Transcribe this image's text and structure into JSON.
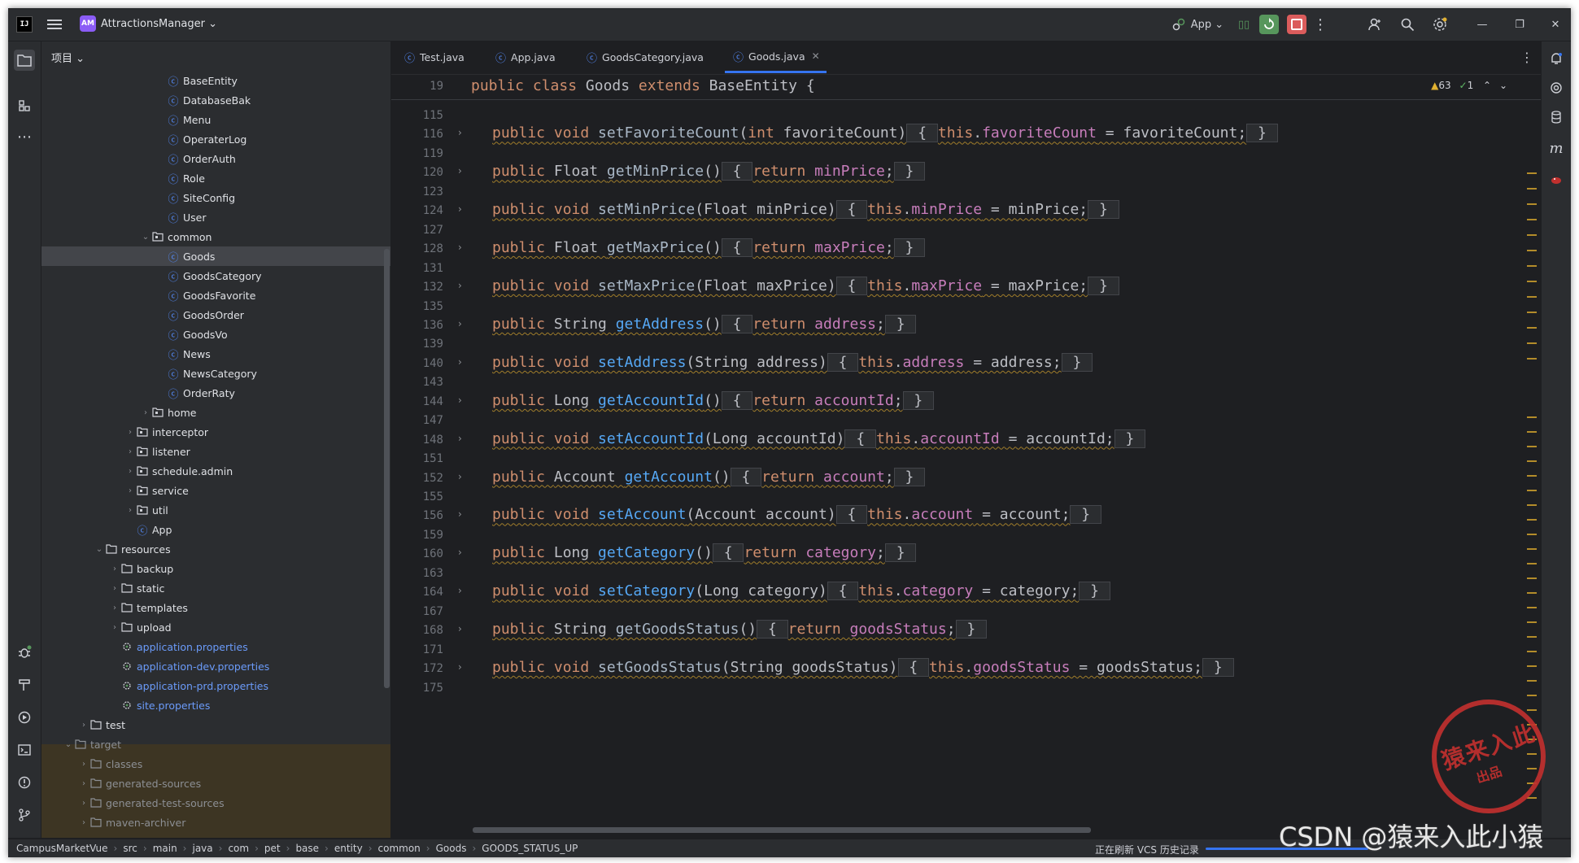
{
  "titlebar": {
    "logo": "IJ",
    "project_badge": "AM",
    "project_name": "AttractionsManager ⌄",
    "run_config": "App ⌄"
  },
  "project_panel": {
    "title": "项目 ⌄",
    "tree": [
      {
        "label": "BaseEntity",
        "type": "class",
        "indent": 6
      },
      {
        "label": "DatabaseBak",
        "type": "class",
        "indent": 6
      },
      {
        "label": "Menu",
        "type": "class",
        "indent": 6
      },
      {
        "label": "OperaterLog",
        "type": "class",
        "indent": 6
      },
      {
        "label": "OrderAuth",
        "type": "class",
        "indent": 6
      },
      {
        "label": "Role",
        "type": "class",
        "indent": 6
      },
      {
        "label": "SiteConfig",
        "type": "class",
        "indent": 6
      },
      {
        "label": "User",
        "type": "class",
        "indent": 6
      },
      {
        "label": "common",
        "type": "package",
        "indent": 5,
        "open": true
      },
      {
        "label": "Goods",
        "type": "class",
        "indent": 6,
        "selected": true
      },
      {
        "label": "GoodsCategory",
        "type": "class",
        "indent": 6
      },
      {
        "label": "GoodsFavorite",
        "type": "class",
        "indent": 6
      },
      {
        "label": "GoodsOrder",
        "type": "class",
        "indent": 6
      },
      {
        "label": "GoodsVo",
        "type": "class",
        "indent": 6
      },
      {
        "label": "News",
        "type": "class",
        "indent": 6
      },
      {
        "label": "NewsCategory",
        "type": "class",
        "indent": 6
      },
      {
        "label": "OrderRaty",
        "type": "class",
        "indent": 6
      },
      {
        "label": "home",
        "type": "package",
        "indent": 5,
        "open": false
      },
      {
        "label": "interceptor",
        "type": "package",
        "indent": 4,
        "open": false
      },
      {
        "label": "listener",
        "type": "package",
        "indent": 4,
        "open": false
      },
      {
        "label": "schedule.admin",
        "type": "package",
        "indent": 4,
        "open": false
      },
      {
        "label": "service",
        "type": "package",
        "indent": 4,
        "open": false
      },
      {
        "label": "util",
        "type": "package",
        "indent": 4,
        "open": false
      },
      {
        "label": "App",
        "type": "app",
        "indent": 4
      },
      {
        "label": "resources",
        "type": "folder",
        "indent": 2,
        "open": true
      },
      {
        "label": "backup",
        "type": "folder",
        "indent": 3,
        "open": false
      },
      {
        "label": "static",
        "type": "folder",
        "indent": 3,
        "open": false
      },
      {
        "label": "templates",
        "type": "folder",
        "indent": 3,
        "open": false
      },
      {
        "label": "upload",
        "type": "folder",
        "indent": 3,
        "open": false
      },
      {
        "label": "application.properties",
        "type": "props",
        "indent": 3
      },
      {
        "label": "application-dev.properties",
        "type": "props",
        "indent": 3
      },
      {
        "label": "application-prd.properties",
        "type": "props",
        "indent": 3
      },
      {
        "label": "site.properties",
        "type": "props",
        "indent": 3
      },
      {
        "label": "test",
        "type": "folder",
        "indent": 1,
        "open": false
      },
      {
        "label": "target",
        "type": "folder",
        "indent": 0,
        "open": true,
        "target": true
      },
      {
        "label": "classes",
        "type": "folder",
        "indent": 1,
        "open": false,
        "target": true
      },
      {
        "label": "generated-sources",
        "type": "folder",
        "indent": 1,
        "open": false,
        "target": true
      },
      {
        "label": "generated-test-sources",
        "type": "folder",
        "indent": 1,
        "open": false,
        "target": true
      },
      {
        "label": "maven-archiver",
        "type": "folder",
        "indent": 1,
        "open": false,
        "target": true
      }
    ]
  },
  "tabs": [
    {
      "label": "Test.java",
      "active": false
    },
    {
      "label": "App.java",
      "active": false
    },
    {
      "label": "GoodsCategory.java",
      "active": false
    },
    {
      "label": "Goods.java",
      "active": true
    }
  ],
  "editor": {
    "sticky_line_number": "19",
    "sticky_code": [
      {
        "t": "public ",
        "c": "kw"
      },
      {
        "t": "class ",
        "c": "kw"
      },
      {
        "t": "Goods "
      },
      {
        "t": "extends ",
        "c": "kw"
      },
      {
        "t": "BaseEntity {"
      }
    ],
    "warnings": "63",
    "checks": "1",
    "lines": [
      {
        "n": "115"
      },
      {
        "n": "116",
        "fold": true,
        "code": [
          {
            "t": "public ",
            "c": "kw"
          },
          {
            "t": "void ",
            "c": "kw"
          },
          {
            "t": "setFavoriteCount",
            "c": "gr"
          },
          {
            "t": "("
          },
          {
            "t": "int ",
            "c": "kw"
          },
          {
            "t": "favoriteCount)"
          },
          {
            "t": " { ",
            "c": "brace"
          },
          {
            "t": "this",
            "c": "kw"
          },
          {
            "t": "."
          },
          {
            "t": "favoriteCount",
            "c": "fld"
          },
          {
            "t": " = favoriteCount;"
          },
          {
            "t": " } ",
            "c": "brace"
          }
        ]
      },
      {
        "n": "119"
      },
      {
        "n": "120",
        "fold": true,
        "code": [
          {
            "t": "public ",
            "c": "kw"
          },
          {
            "t": "Float "
          },
          {
            "t": "getMinPrice",
            "c": "gr"
          },
          {
            "t": "()"
          },
          {
            "t": " { ",
            "c": "brace"
          },
          {
            "t": "return ",
            "c": "kw"
          },
          {
            "t": "minPrice",
            "c": "fld"
          },
          {
            "t": ";"
          },
          {
            "t": " } ",
            "c": "brace"
          }
        ]
      },
      {
        "n": "123"
      },
      {
        "n": "124",
        "fold": true,
        "code": [
          {
            "t": "public ",
            "c": "kw"
          },
          {
            "t": "void ",
            "c": "kw"
          },
          {
            "t": "setMinPrice",
            "c": "gr"
          },
          {
            "t": "(Float minPrice)"
          },
          {
            "t": " { ",
            "c": "brace"
          },
          {
            "t": "this",
            "c": "kw"
          },
          {
            "t": "."
          },
          {
            "t": "minPrice",
            "c": "fld"
          },
          {
            "t": " = minPrice;"
          },
          {
            "t": " } ",
            "c": "brace"
          }
        ]
      },
      {
        "n": "127"
      },
      {
        "n": "128",
        "fold": true,
        "code": [
          {
            "t": "public ",
            "c": "kw"
          },
          {
            "t": "Float "
          },
          {
            "t": "getMaxPrice",
            "c": "gr"
          },
          {
            "t": "()"
          },
          {
            "t": " { ",
            "c": "brace"
          },
          {
            "t": "return ",
            "c": "kw"
          },
          {
            "t": "maxPrice",
            "c": "fld"
          },
          {
            "t": ";"
          },
          {
            "t": " } ",
            "c": "brace"
          }
        ]
      },
      {
        "n": "131"
      },
      {
        "n": "132",
        "fold": true,
        "code": [
          {
            "t": "public ",
            "c": "kw"
          },
          {
            "t": "void ",
            "c": "kw"
          },
          {
            "t": "setMaxPrice",
            "c": "gr"
          },
          {
            "t": "(Float maxPrice)"
          },
          {
            "t": " { ",
            "c": "brace"
          },
          {
            "t": "this",
            "c": "kw"
          },
          {
            "t": "."
          },
          {
            "t": "maxPrice",
            "c": "fld"
          },
          {
            "t": " = maxPrice;"
          },
          {
            "t": " } ",
            "c": "brace"
          }
        ]
      },
      {
        "n": "135"
      },
      {
        "n": "136",
        "fold": true,
        "code": [
          {
            "t": "public ",
            "c": "kw"
          },
          {
            "t": "String "
          },
          {
            "t": "getAddress",
            "c": "fn"
          },
          {
            "t": "()"
          },
          {
            "t": " { ",
            "c": "brace"
          },
          {
            "t": "return ",
            "c": "kw"
          },
          {
            "t": "address",
            "c": "fld"
          },
          {
            "t": ";"
          },
          {
            "t": " } ",
            "c": "brace"
          }
        ]
      },
      {
        "n": "139"
      },
      {
        "n": "140",
        "fold": true,
        "code": [
          {
            "t": "public ",
            "c": "kw"
          },
          {
            "t": "void ",
            "c": "kw"
          },
          {
            "t": "setAddress",
            "c": "fn"
          },
          {
            "t": "(String address)"
          },
          {
            "t": " { ",
            "c": "brace"
          },
          {
            "t": "this",
            "c": "kw"
          },
          {
            "t": "."
          },
          {
            "t": "address",
            "c": "fld"
          },
          {
            "t": " = address;"
          },
          {
            "t": " } ",
            "c": "brace"
          }
        ]
      },
      {
        "n": "143"
      },
      {
        "n": "144",
        "fold": true,
        "code": [
          {
            "t": "public ",
            "c": "kw"
          },
          {
            "t": "Long "
          },
          {
            "t": "getAccountId",
            "c": "fn"
          },
          {
            "t": "()"
          },
          {
            "t": " { ",
            "c": "brace"
          },
          {
            "t": "return ",
            "c": "kw"
          },
          {
            "t": "accountId",
            "c": "fld"
          },
          {
            "t": ";"
          },
          {
            "t": " } ",
            "c": "brace"
          }
        ]
      },
      {
        "n": "147"
      },
      {
        "n": "148",
        "fold": true,
        "code": [
          {
            "t": "public ",
            "c": "kw"
          },
          {
            "t": "void ",
            "c": "kw"
          },
          {
            "t": "setAccountId",
            "c": "fn"
          },
          {
            "t": "(Long accountId)"
          },
          {
            "t": " { ",
            "c": "brace"
          },
          {
            "t": "this",
            "c": "kw"
          },
          {
            "t": "."
          },
          {
            "t": "accountId",
            "c": "fld"
          },
          {
            "t": " = accountId;"
          },
          {
            "t": " } ",
            "c": "brace"
          }
        ]
      },
      {
        "n": "151"
      },
      {
        "n": "152",
        "fold": true,
        "code": [
          {
            "t": "public ",
            "c": "kw"
          },
          {
            "t": "Account "
          },
          {
            "t": "getAccount",
            "c": "fn"
          },
          {
            "t": "()"
          },
          {
            "t": " { ",
            "c": "brace"
          },
          {
            "t": "return ",
            "c": "kw"
          },
          {
            "t": "account",
            "c": "fld"
          },
          {
            "t": ";"
          },
          {
            "t": " } ",
            "c": "brace"
          }
        ]
      },
      {
        "n": "155"
      },
      {
        "n": "156",
        "fold": true,
        "code": [
          {
            "t": "public ",
            "c": "kw"
          },
          {
            "t": "void ",
            "c": "kw"
          },
          {
            "t": "setAccount",
            "c": "fn"
          },
          {
            "t": "(Account account)"
          },
          {
            "t": " { ",
            "c": "brace"
          },
          {
            "t": "this",
            "c": "kw"
          },
          {
            "t": "."
          },
          {
            "t": "account",
            "c": "fld"
          },
          {
            "t": " = account;"
          },
          {
            "t": " } ",
            "c": "brace"
          }
        ]
      },
      {
        "n": "159"
      },
      {
        "n": "160",
        "fold": true,
        "code": [
          {
            "t": "public ",
            "c": "kw"
          },
          {
            "t": "Long "
          },
          {
            "t": "getCategory",
            "c": "fn"
          },
          {
            "t": "()"
          },
          {
            "t": " { ",
            "c": "brace"
          },
          {
            "t": "return ",
            "c": "kw"
          },
          {
            "t": "category",
            "c": "fld"
          },
          {
            "t": ";"
          },
          {
            "t": " } ",
            "c": "brace"
          }
        ]
      },
      {
        "n": "163"
      },
      {
        "n": "164",
        "fold": true,
        "code": [
          {
            "t": "public ",
            "c": "kw"
          },
          {
            "t": "void ",
            "c": "kw"
          },
          {
            "t": "setCategory",
            "c": "fn"
          },
          {
            "t": "(Long category)"
          },
          {
            "t": " { ",
            "c": "brace"
          },
          {
            "t": "this",
            "c": "kw"
          },
          {
            "t": "."
          },
          {
            "t": "category",
            "c": "fld"
          },
          {
            "t": " = category;"
          },
          {
            "t": " } ",
            "c": "brace"
          }
        ]
      },
      {
        "n": "167"
      },
      {
        "n": "168",
        "fold": true,
        "code": [
          {
            "t": "public ",
            "c": "kw"
          },
          {
            "t": "String "
          },
          {
            "t": "getGoodsStatus",
            "c": "gr"
          },
          {
            "t": "()"
          },
          {
            "t": " { ",
            "c": "brace"
          },
          {
            "t": "return ",
            "c": "kw"
          },
          {
            "t": "goodsStatus",
            "c": "fld"
          },
          {
            "t": ";"
          },
          {
            "t": " } ",
            "c": "brace"
          }
        ]
      },
      {
        "n": "171"
      },
      {
        "n": "172",
        "fold": true,
        "code": [
          {
            "t": "public ",
            "c": "kw"
          },
          {
            "t": "void ",
            "c": "kw"
          },
          {
            "t": "setGoodsStatus",
            "c": "gr"
          },
          {
            "t": "(String goodsStatus)"
          },
          {
            "t": " { ",
            "c": "brace"
          },
          {
            "t": "this",
            "c": "kw"
          },
          {
            "t": "."
          },
          {
            "t": "goodsStatus",
            "c": "fld"
          },
          {
            "t": " = goodsStatus;"
          },
          {
            "t": " } ",
            "c": "brace"
          }
        ]
      },
      {
        "n": "175"
      }
    ]
  },
  "statusbar": {
    "breadcrumb": [
      "CampusMarketVue",
      "src",
      "main",
      "java",
      "com",
      "pet",
      "base",
      "entity",
      "common",
      "Goods",
      "GOODS_STATUS_UP"
    ],
    "vcs_text": "正在刷新 VCS 历史记录"
  },
  "watermark": {
    "stamp_main": "猿来入此",
    "stamp_sub": "出品",
    "csdn": "CSDN @猿来入此小猿"
  },
  "colors": {
    "accent": "#3574f0",
    "keyword": "#cf8e6d",
    "method": "#56a8f5",
    "field": "#c77dbb",
    "stamp": "#c0302e"
  }
}
